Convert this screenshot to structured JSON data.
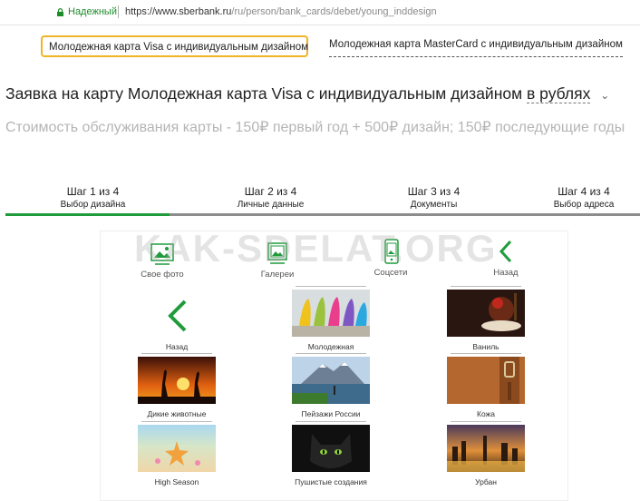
{
  "browser": {
    "secure_label": "Надежный",
    "url_host": "https://www.sberbank.ru",
    "url_path": "/ru/person/bank_cards/debet/young_inddesign"
  },
  "card_tabs": [
    {
      "label": "Молодежная карта Visa с индивидуальным дизайном",
      "active": true
    },
    {
      "label": "Молодежная карта MasterCard с индивидуальным дизайном",
      "active": false
    }
  ],
  "application": {
    "title": "Заявка на карту Молодежная карта Visa с индивидуальным дизайном",
    "currency": "в рублях"
  },
  "cost_text": "Стоимость обслуживания карты - 150₽ первый год + 500₽ дизайн; 150₽ последующие годы",
  "steps": [
    {
      "number": "Шаг 1 из 4",
      "label": "Выбор дизайна"
    },
    {
      "number": "Шаг 2 из 4",
      "label": "Личные данные"
    },
    {
      "number": "Шаг 3 из 4",
      "label": "Документы"
    },
    {
      "number": "Шаг 4 из 4",
      "label": "Выбор адреса"
    }
  ],
  "step_progress": 0.25,
  "watermark": "KAK-SDELAT.ORG",
  "designer": {
    "sources": [
      "Свое фото",
      "Галереи",
      "Соцсети",
      "Назад"
    ],
    "back_label": "Назад",
    "galleries": [
      "Молодежная",
      "Ваниль",
      "Дикие животные",
      "Пейзажи России",
      "Кожа",
      "High Season",
      "Пушистые создания",
      "Урбан"
    ]
  },
  "colors": {
    "accent_green": "#1f9b3c",
    "tab_border": "#f0b428",
    "cost_grey": "#b5b5b5"
  }
}
